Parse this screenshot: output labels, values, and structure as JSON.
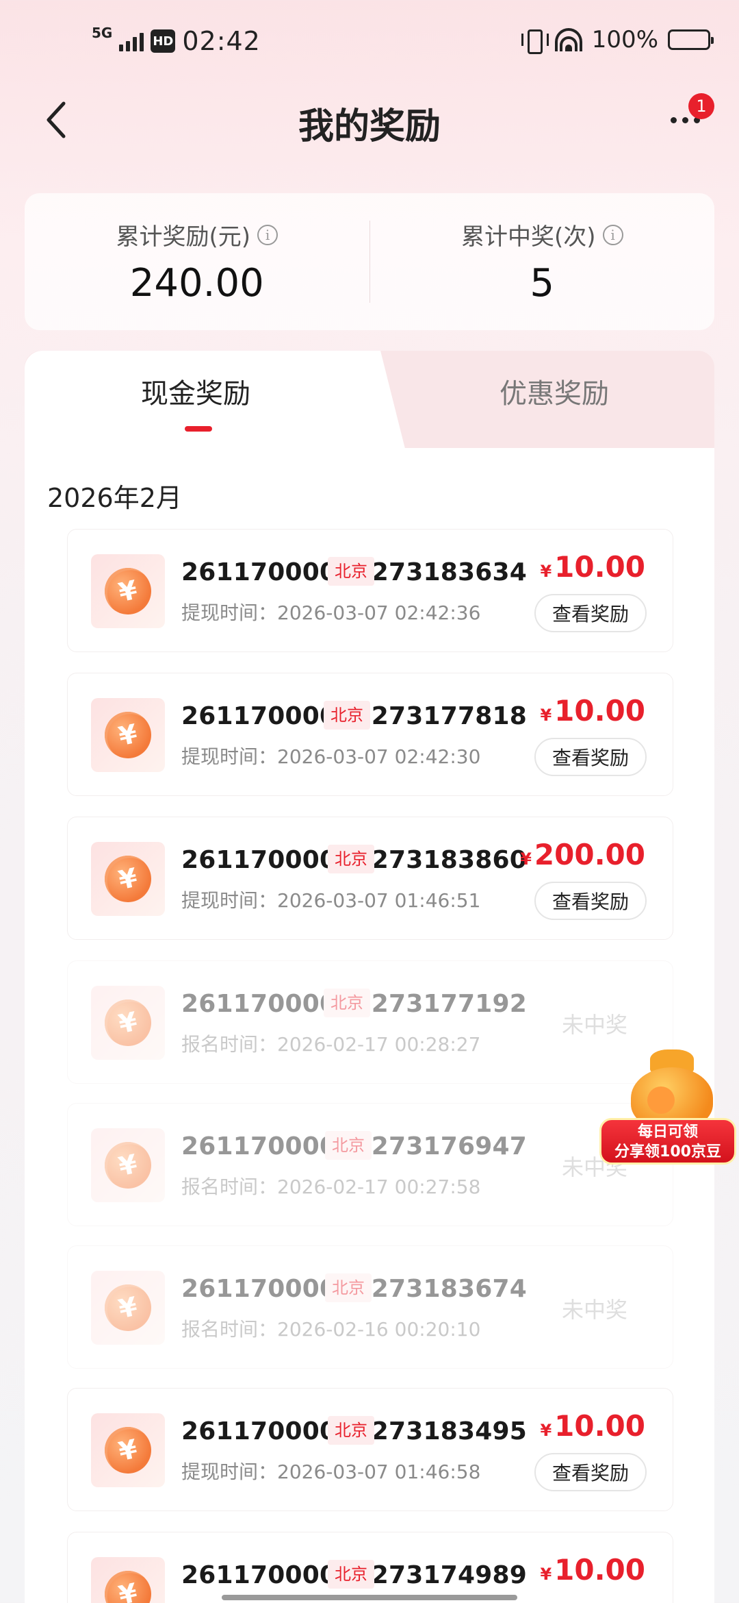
{
  "status_bar": {
    "network": "5G",
    "hd": "HD",
    "time": "02:42",
    "battery": "100%"
  },
  "header": {
    "title": "我的奖励",
    "badge_count": "1"
  },
  "summary": {
    "total_reward_label": "累计奖励(元)",
    "total_reward_value": "240.00",
    "total_wins_label": "累计中奖(次)",
    "total_wins_value": "5"
  },
  "tabs": {
    "cash": "现金奖励",
    "coupon": "优惠奖励"
  },
  "month": "2026年2月",
  "records": [
    {
      "id": "26117000000273183634",
      "city": "北京",
      "time_label": "提现时间：",
      "time": "2026-03-07 02:42:36",
      "currency": "¥",
      "amount": "10.00",
      "button": "查看奖励",
      "won": true
    },
    {
      "id": "26117000000273177818",
      "city": "北京",
      "time_label": "提现时间：",
      "time": "2026-03-07 02:42:30",
      "currency": "¥",
      "amount": "10.00",
      "button": "查看奖励",
      "won": true
    },
    {
      "id": "26117000000273183860",
      "city": "北京",
      "time_label": "提现时间：",
      "time": "2026-03-07 01:46:51",
      "currency": "¥",
      "amount": "200.00",
      "button": "查看奖励",
      "won": true
    },
    {
      "id": "26117000000273177192",
      "city": "北京",
      "time_label": "报名时间：",
      "time": "2026-02-17 00:28:27",
      "status": "未中奖",
      "won": false
    },
    {
      "id": "26117000000273176947",
      "city": "北京",
      "time_label": "报名时间：",
      "time": "2026-02-17 00:27:58",
      "status": "未中奖",
      "won": false
    },
    {
      "id": "26117000000273183674",
      "city": "北京",
      "time_label": "报名时间：",
      "time": "2026-02-16 00:20:10",
      "status": "未中奖",
      "won": false
    },
    {
      "id": "26117000000273183495",
      "city": "北京",
      "time_label": "提现时间：",
      "time": "2026-03-07 01:46:58",
      "currency": "¥",
      "amount": "10.00",
      "button": "查看奖励",
      "won": true
    },
    {
      "id": "26117000000273174989",
      "city": "北京",
      "currency": "¥",
      "amount": "10.00",
      "won": true
    }
  ],
  "promo": {
    "line1": "每日可领",
    "line2": "分享领100京豆"
  },
  "colors": {
    "accent": "#e8202c",
    "coin": "#f47a3a"
  }
}
